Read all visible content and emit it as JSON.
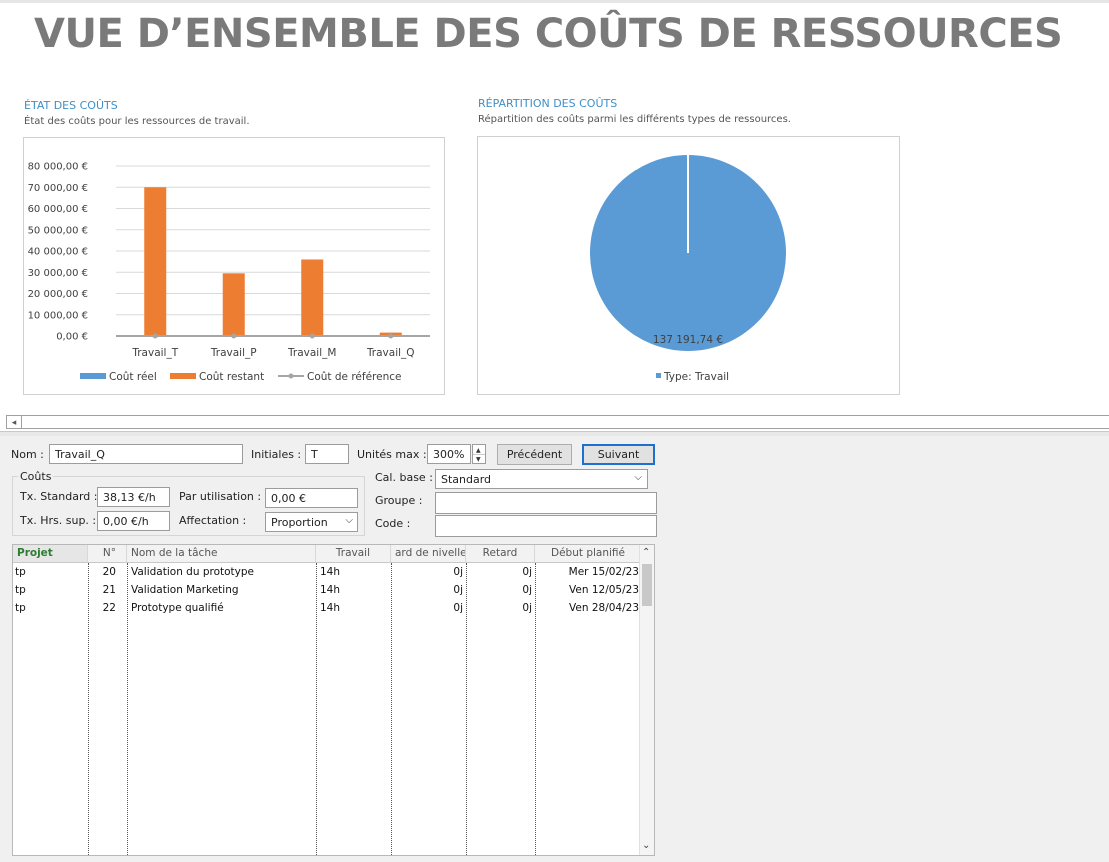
{
  "report": {
    "title": "VUE D’ENSEMBLE DES COÛTS DE RESSOURCES",
    "cost_status": {
      "title": "ÉTAT DES COÛTS",
      "subtitle": "État des coûts pour les ressources de travail."
    },
    "cost_distribution": {
      "title": "RÉPARTITION DES COÛTS",
      "subtitle": "Répartition des coûts parmi les différents types de ressources."
    }
  },
  "chart_data": [
    {
      "type": "bar",
      "categories": [
        "Travail_T",
        "Travail_P",
        "Travail_M",
        "Travail_Q"
      ],
      "series": [
        {
          "name": "Coût réel",
          "values": [
            0,
            0,
            0,
            0
          ],
          "color": "#5b9bd5",
          "kind": "bar"
        },
        {
          "name": "Coût restant",
          "values": [
            70000,
            29500,
            36000,
            1600
          ],
          "color": "#ed7d31",
          "kind": "bar"
        },
        {
          "name": "Coût de référence",
          "values": [
            0,
            0,
            0,
            0
          ],
          "color": "#a5a5a5",
          "kind": "line"
        }
      ],
      "y_ticks": [
        "0,00 €",
        "10 000,00 €",
        "20 000,00 €",
        "30 000,00 €",
        "40 000,00 €",
        "50 000,00 €",
        "60 000,00 €",
        "70 000,00 €",
        "80 000,00 €"
      ],
      "ylim": [
        0,
        80000
      ],
      "grid": true,
      "legend": "bottom"
    },
    {
      "type": "pie",
      "labels": [
        "Type: Travail"
      ],
      "values": [
        137191.74
      ],
      "data_labels": [
        "137 191,74 €"
      ],
      "colors": [
        "#5b9bd5"
      ],
      "legend": "bottom"
    }
  ],
  "form": {
    "name_label": "Nom :",
    "name_value": "Travail_Q",
    "initials_label": "Initiales :",
    "initials_value": "T",
    "max_units_label": "Unités max :",
    "max_units_value": "300%",
    "prev_button": "Précédent",
    "next_button": "Suivant",
    "costs_group": "Coûts",
    "std_rate_label": "Tx. Standard :",
    "std_rate_value": "38,13 €/h",
    "ovt_rate_label": "Tx. Hrs. sup. :",
    "ovt_rate_value": "0,00 €/h",
    "per_use_label": "Par utilisation :",
    "per_use_value": "0,00 €",
    "accrue_label": "Affectation :",
    "accrue_value": "Proportion",
    "base_cal_label": "Cal. base :",
    "base_cal_value": "Standard",
    "group_label": "Groupe :",
    "group_value": "",
    "code_label": "Code :",
    "code_value": ""
  },
  "table": {
    "headers": [
      "Projet",
      "N°",
      "Nom de la tâche",
      "Travail",
      "ard de nivellen",
      "Retard",
      "Début planifié"
    ],
    "rows": [
      [
        "tp",
        "20",
        "Validation du prototype",
        "14h",
        "0j",
        "0j",
        "Mer 15/02/23"
      ],
      [
        "tp",
        "21",
        "Validation Marketing",
        "14h",
        "0j",
        "0j",
        "Ven 12/05/23"
      ],
      [
        "tp",
        "22",
        "Prototype qualifié",
        "14h",
        "0j",
        "0j",
        "Ven 28/04/23"
      ]
    ]
  }
}
